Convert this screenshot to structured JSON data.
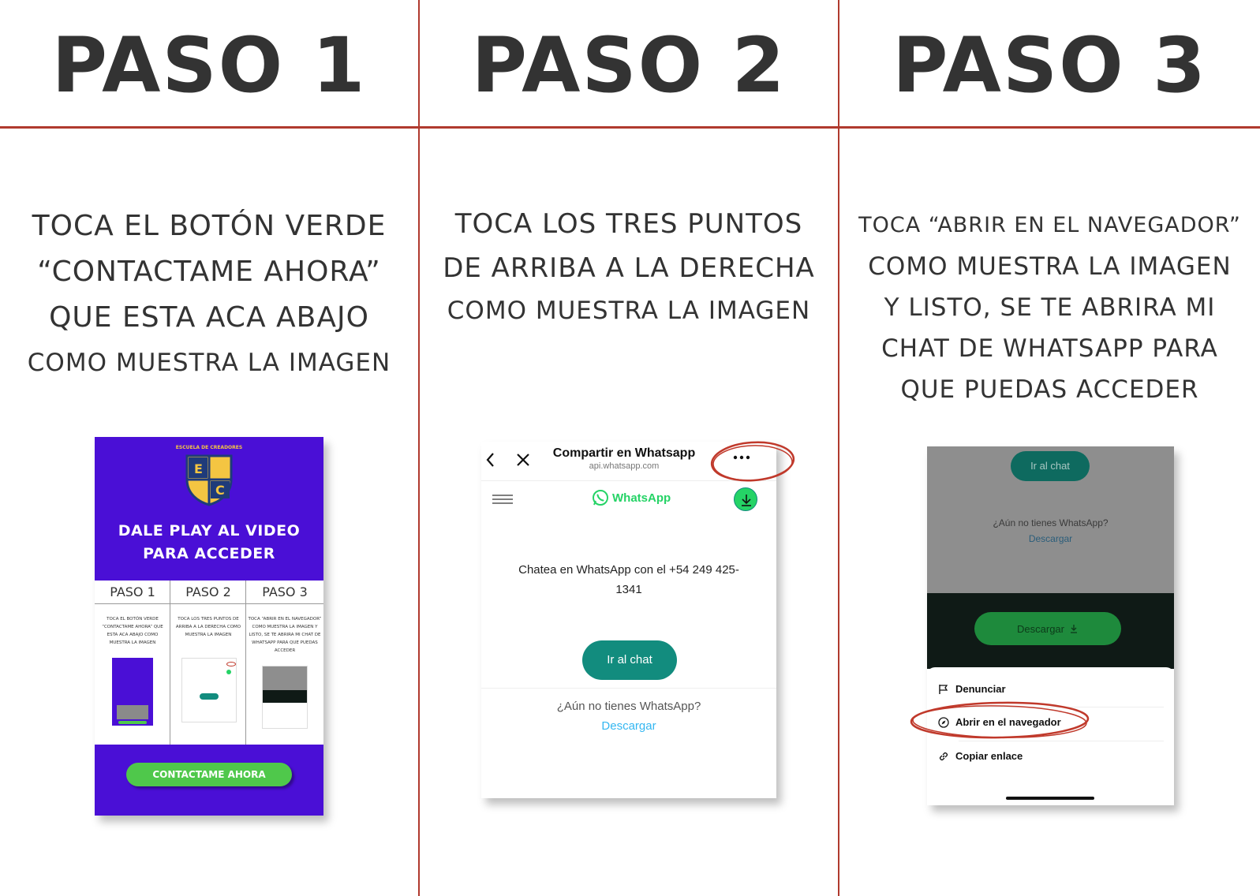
{
  "steps": [
    {
      "title": "PASO 1",
      "lines": [
        "TOCA EL BOTÓN VERDE",
        "“CONTACTAME AHORA”",
        "QUE ESTA ACA ABAJO",
        "COMO MUESTRA LA IMAGEN"
      ]
    },
    {
      "title": "PASO 2",
      "lines": [
        "TOCA LOS TRES PUNTOS",
        "DE ARRIBA A LA DERECHA",
        "COMO MUESTRA LA IMAGEN"
      ]
    },
    {
      "title": "PASO 3",
      "lines": [
        "TOCA “ABRIR EN EL NAVEGADOR”",
        "COMO MUESTRA LA IMAGEN",
        "Y LISTO, SE TE ABRIRA MI",
        "CHAT DE WHATSAPP PARA",
        "QUE PUEDAS ACCEDER"
      ]
    }
  ],
  "card1": {
    "logo_text": "ESCUELA DE CREADORES",
    "logo_letters": [
      "E",
      "C"
    ],
    "title_line1": "DALE PLAY AL VIDEO",
    "title_line2": "PARA ACCEDER",
    "mini_headers": [
      "PASO 1",
      "PASO 2",
      "PASO 3"
    ],
    "mini_texts": [
      "TOCA EL BOTÓN VERDE “CONTACTAME AHORA” QUE ESTA ACA ABAJO COMO MUESTRA LA IMAGEN",
      "TOCA LOS TRES PUNTOS DE ARRIBA A LA DERECHA COMO MUESTRA LA IMAGEN",
      "TOCA “ABRIR EN EL NAVEGADOR” COMO MUESTRA LA IMAGEN Y LISTO, SE TE ABRIRA MI CHAT DE WHATSAPP PARA QUE PUEDAS ACCEDER"
    ],
    "button_label": "CONTACTAME AHORA"
  },
  "card2": {
    "back_icon": "chevron-left-icon",
    "close_icon": "close-icon",
    "title": "Compartir en Whatsapp",
    "subtitle": "api.whatsapp.com",
    "more_icon": "more-dots-icon",
    "menu_icon": "hamburger-icon",
    "brand": "WhatsApp",
    "download_icon": "download-icon",
    "chat_text_line1": "Chatea en WhatsApp con el +54 249 425-",
    "chat_text_line2": "1341",
    "chat_button": "Ir al chat",
    "no_app_text": "¿Aún no tienes WhatsApp?",
    "download_link": "Descargar",
    "accent_color": "#25d366",
    "button_color": "#128c7e",
    "link_color": "#34b7f1",
    "highlight_color": "#c0392b"
  },
  "card3": {
    "chat_button": "Ir al chat",
    "no_app_text": "¿Aún no tienes WhatsApp?",
    "download_link": "Descargar",
    "download_button": "Descargar",
    "menu": [
      {
        "label": "Denunciar",
        "icon": "flag-icon"
      },
      {
        "label": "Abrir en el navegador",
        "icon": "compass-icon"
      },
      {
        "label": "Copiar enlace",
        "icon": "link-icon"
      }
    ]
  }
}
